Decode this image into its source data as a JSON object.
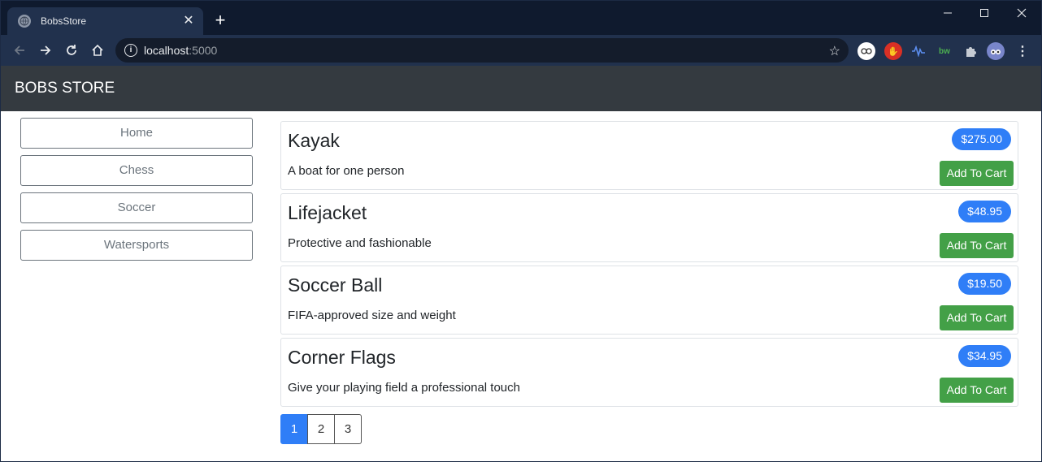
{
  "browser": {
    "tab_title": "BobsStore",
    "url_host": "localhost",
    "url_port": ":5000"
  },
  "site": {
    "brand": "BOBS STORE"
  },
  "categories": [
    "Home",
    "Chess",
    "Soccer",
    "Watersports"
  ],
  "products": [
    {
      "name": "Kayak",
      "description": "A boat for one person",
      "price": "$275.00",
      "cart_label": "Add To Cart"
    },
    {
      "name": "Lifejacket",
      "description": "Protective and fashionable",
      "price": "$48.95",
      "cart_label": "Add To Cart"
    },
    {
      "name": "Soccer Ball",
      "description": "FIFA-approved size and weight",
      "price": "$19.50",
      "cart_label": "Add To Cart"
    },
    {
      "name": "Corner Flags",
      "description": "Give your playing field a professional touch",
      "price": "$34.95",
      "cart_label": "Add To Cart"
    }
  ],
  "pagination": {
    "pages": [
      "1",
      "2",
      "3"
    ],
    "active": "1"
  },
  "colors": {
    "navbar": "#343a40",
    "price_badge": "#2f7ef7",
    "cart_button": "#43a047",
    "active_page": "#2f7ef7"
  }
}
